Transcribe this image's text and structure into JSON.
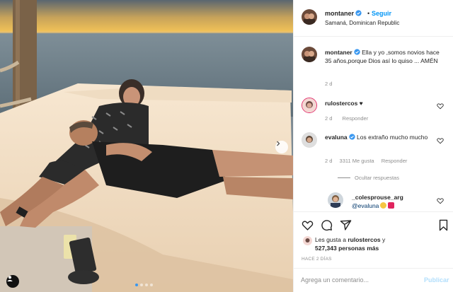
{
  "post": {
    "username": "montaner",
    "follow_label": "Seguir",
    "separator": "•",
    "location": "Samaná, Dominican Republic",
    "caption_text": "Ella y yo ,somos novios hace 35 años,porque Dios así lo quiso ... AMÉN",
    "caption_time": "2 d",
    "carousel_dots": 4,
    "carousel_active": 1
  },
  "comments": [
    {
      "username": "rulostercos",
      "text": "♥",
      "time": "2 d",
      "reply_label": "Responder"
    },
    {
      "username": "evaluna",
      "text": "Los extraño mucho mucho",
      "time": "2 d",
      "likes": "3311 Me gusta",
      "reply_label": "Responder",
      "hide_replies_label": "Ocultar respuestas",
      "reply": {
        "username": "_colesprouse_arg",
        "mention": "@evaluna"
      }
    }
  ],
  "footer": {
    "likes_prefix": "Les gusta a",
    "likes_user": "rulostercos",
    "likes_connector": "y",
    "likes_count": "527,343 personas más",
    "posted_ago": "HACE 2 DÍAS",
    "comment_placeholder": "Agrega un comentario...",
    "publish_label": "Publicar"
  },
  "colors": {
    "accent": "#0095f6",
    "verified": "#3897f0",
    "muted": "#8e8e8e",
    "text": "#262626"
  },
  "icons": [
    "verified-badge-icon",
    "heart-icon",
    "comment-icon",
    "share-icon",
    "save-icon",
    "chevron-right-icon",
    "user-tag-icon"
  ]
}
